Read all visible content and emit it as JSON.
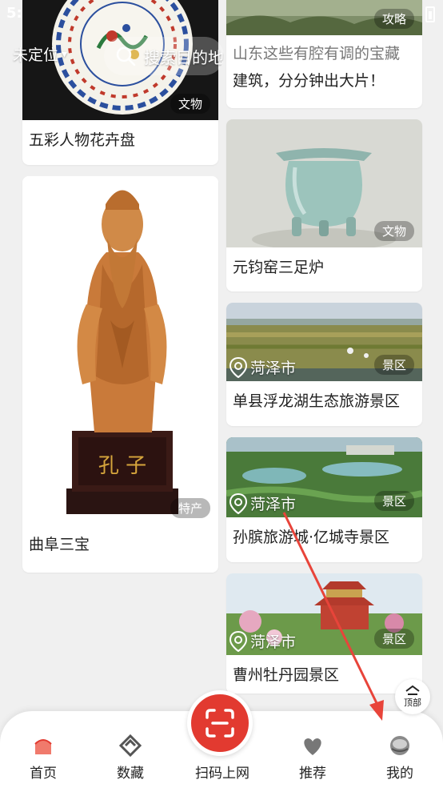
{
  "status_bar": {
    "time": "5:"
  },
  "header": {
    "location": "未定位",
    "search_placeholder": "搜索目的地"
  },
  "feed": {
    "left": [
      {
        "title": "五彩人物花卉盘",
        "tag": "文物"
      },
      {
        "title": "曲阜三宝",
        "tag": "特产",
        "statue_text": "孔 子"
      }
    ],
    "right": [
      {
        "title_overlay": "山东这些有腔有调的宝藏",
        "title": "建筑，分分钟出大片！",
        "tag": "攻略"
      },
      {
        "title": "元钧窑三足炉",
        "tag": "文物"
      },
      {
        "title": "单县浮龙湖生态旅游景区",
        "tag": "景区",
        "location": "菏泽市"
      },
      {
        "title": "孙膑旅游城·亿城寺景区",
        "tag": "景区",
        "location": "菏泽市"
      },
      {
        "title": "曹州牡丹园景区",
        "tag": "景区",
        "location": "菏泽市"
      }
    ]
  },
  "top_button": {
    "label": "顶部"
  },
  "bottom_nav": {
    "items": [
      {
        "label": "首页",
        "icon": "home-icon",
        "active": true
      },
      {
        "label": "数藏",
        "icon": "collection-icon"
      },
      {
        "label": "扫码上网",
        "icon": "scan-icon"
      },
      {
        "label": "推荐",
        "icon": "heart-icon"
      },
      {
        "label": "我的",
        "icon": "profile-icon"
      }
    ]
  },
  "colors": {
    "accent": "#e23a30",
    "annotation_arrow": "#e8443a"
  }
}
